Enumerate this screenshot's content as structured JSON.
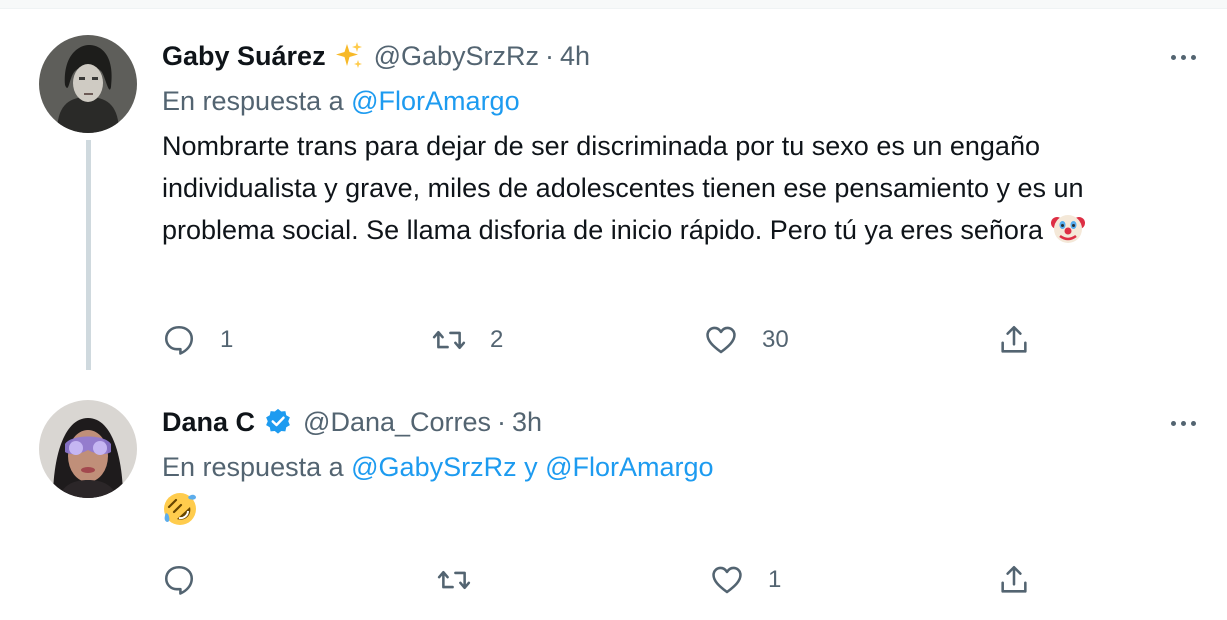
{
  "tweets": [
    {
      "author_name": "Gaby Suárez",
      "author_badge_icon": "sparkles-icon",
      "handle": "@GabySrzRz",
      "separator": "·",
      "time": "4h",
      "reply_prefix": "En respuesta a",
      "reply_mentions": "@FlorAmargo",
      "reply_joiner": "",
      "reply_mentions_2": "",
      "text": "Nombrarte trans para dejar de ser discriminada por tu sexo es un engaño individualista y grave, miles de adolescentes tienen ese pensamiento y es un problema social. Se llama disforia de inicio rápido. Pero tú ya eres señora",
      "trailing_emoji_icon": "clown-face-icon",
      "replies": "1",
      "retweets": "2",
      "likes": "30"
    },
    {
      "author_name": "Dana C",
      "author_badge_icon": "verified-badge-icon",
      "handle": "@Dana_Corres",
      "separator": "·",
      "time": "3h",
      "reply_prefix": "En respuesta a",
      "reply_mentions": "@GabySrzRz",
      "reply_joiner": "y",
      "reply_mentions_2": "@FlorAmargo",
      "text": "",
      "trailing_emoji_icon": "rolling-on-floor-laughing-icon",
      "replies": "",
      "retweets": "",
      "likes": "1"
    }
  ],
  "colors": {
    "text": "#0f1419",
    "secondary": "#536471",
    "link": "#1d9bf0",
    "verified": "#1d9bf0",
    "thread_line": "#cfd9de"
  }
}
